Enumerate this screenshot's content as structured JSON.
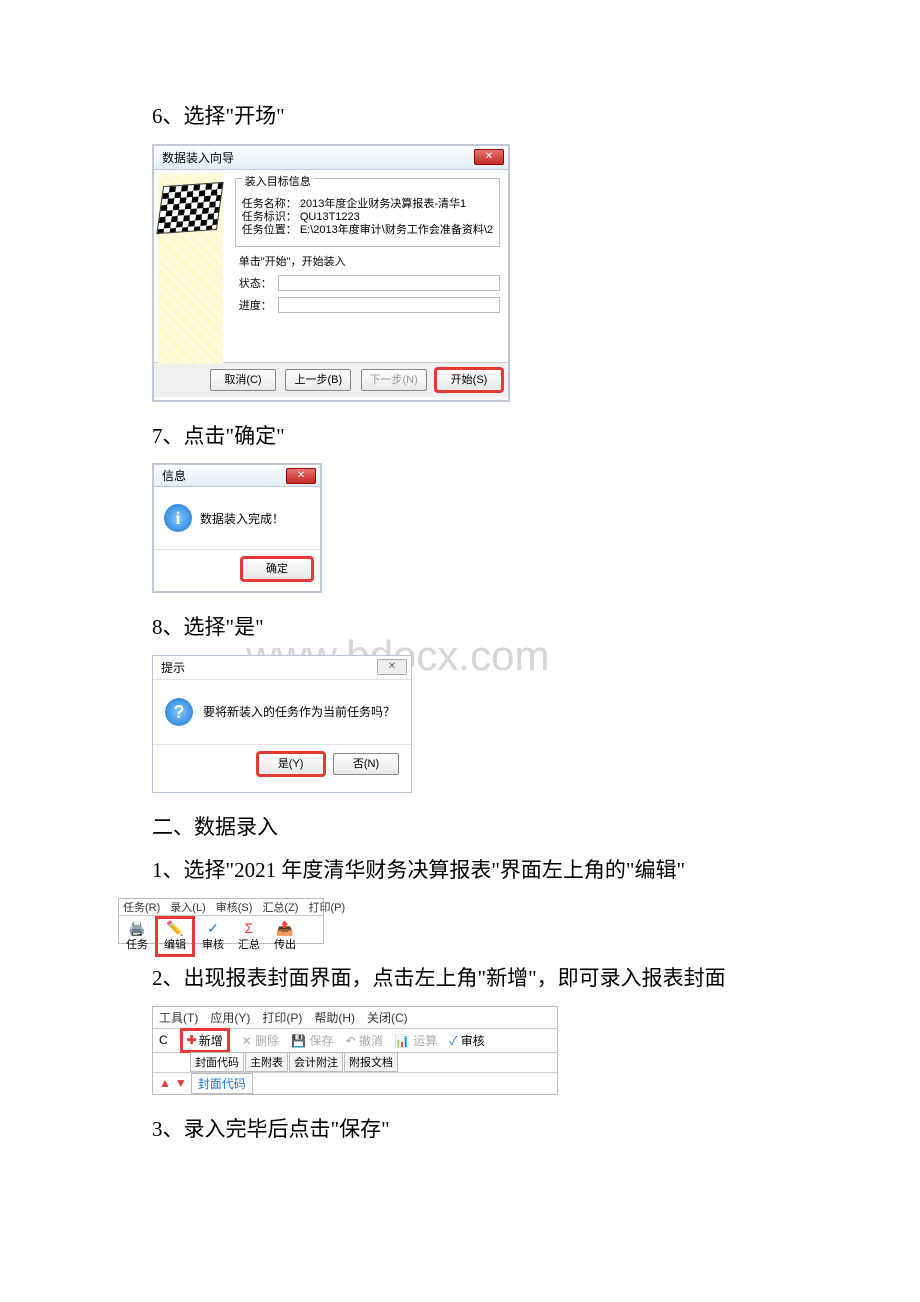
{
  "step6": {
    "label": "6、选择\"开场\"",
    "dlg_title": "数据装入向导",
    "group_title": "装入目标信息",
    "row_name_label": "任务名称：",
    "row_name_val": "2013年度企业财务决算报表-清华1",
    "row_id_label": "任务标识：",
    "row_id_val": "QU13T1223",
    "row_loc_label": "任务位置：",
    "row_loc_val": "E:\\2013年度审计\\财务工作会准备资料\\2",
    "hint": "单击\"开始\"，开始装入",
    "status_label": "状态：",
    "progress_label": "进度：",
    "btn_cancel": "取消(C)",
    "btn_prev": "上一步(B)",
    "btn_next": "下一步(N)",
    "btn_start": "开始(S)"
  },
  "step7": {
    "label": "7、点击\"确定\"",
    "dlg_title": "信息",
    "msg": "数据装入完成！",
    "btn_ok": "确定"
  },
  "step8": {
    "label": "8、选择\"是\"",
    "dlg_title": "提示",
    "msg": "要将新装入的任务作为当前任务吗？",
    "btn_yes": "是(Y)",
    "btn_no": "否(N)"
  },
  "watermark": "www.bdocx.com",
  "section2_title": "二、数据录入",
  "step2_1": {
    "label": "1、选择\"2021 年度清华财务决算报表\"界面左上角的\"编辑\"",
    "menus": {
      "m1": "任务(R)",
      "m2": "录入(L)",
      "m3": "审核(S)",
      "m4": "汇总(Z)",
      "m5": "打印(P)"
    },
    "tbbtns": {
      "b1": "任务",
      "b2": "编辑",
      "b3": "审核",
      "b4": "汇总",
      "b5": "传出"
    }
  },
  "step2_2": {
    "label": "2、出现报表封面界面，点击左上角\"新增\"，即可录入报表封面",
    "menus": {
      "m1": "工具(T)",
      "m2": "应用(Y)",
      "m3": "打印(P)",
      "m4": "帮助(H)",
      "m5": "关闭(C)"
    },
    "left_c": "C",
    "add": "新增",
    "del": "删除",
    "save": "保存",
    "undo": "撤消",
    "calc": "运算",
    "check": "审核",
    "tabs": {
      "t1": "封面代码",
      "t2": "主附表",
      "t3": "会计附注",
      "t4": "附报文档"
    },
    "row4_label": "封面代码"
  },
  "step2_3": {
    "label": "3、录入完毕后点击\"保存\""
  }
}
